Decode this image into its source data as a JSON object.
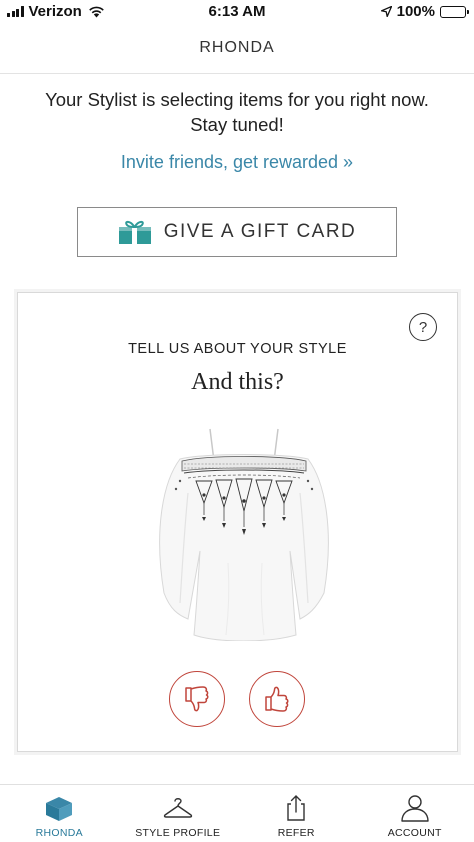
{
  "status_bar": {
    "carrier": "Verizon",
    "time": "6:13 AM",
    "battery": "100%"
  },
  "header": {
    "title": "RHONDA"
  },
  "stylist_message": "Your Stylist is selecting items for you right now. Stay tuned!",
  "invite_link": "Invite friends, get rewarded »",
  "gift_card_button": {
    "label": "GIVE A GIFT CARD"
  },
  "style_card": {
    "help_label": "?",
    "eyebrow": "TELL US ABOUT YOUR STYLE",
    "question": "And this?"
  },
  "tabs": [
    {
      "label": "RHONDA",
      "icon": "box-icon",
      "active": true
    },
    {
      "label": "STYLE PROFILE",
      "icon": "hanger-icon",
      "active": false
    },
    {
      "label": "REFER",
      "icon": "share-icon",
      "active": false
    },
    {
      "label": "ACCOUNT",
      "icon": "person-icon",
      "active": false
    }
  ],
  "colors": {
    "accent": "#3a87a8",
    "teal_icon": "#2e9a98",
    "vote_red": "#c0453b"
  }
}
